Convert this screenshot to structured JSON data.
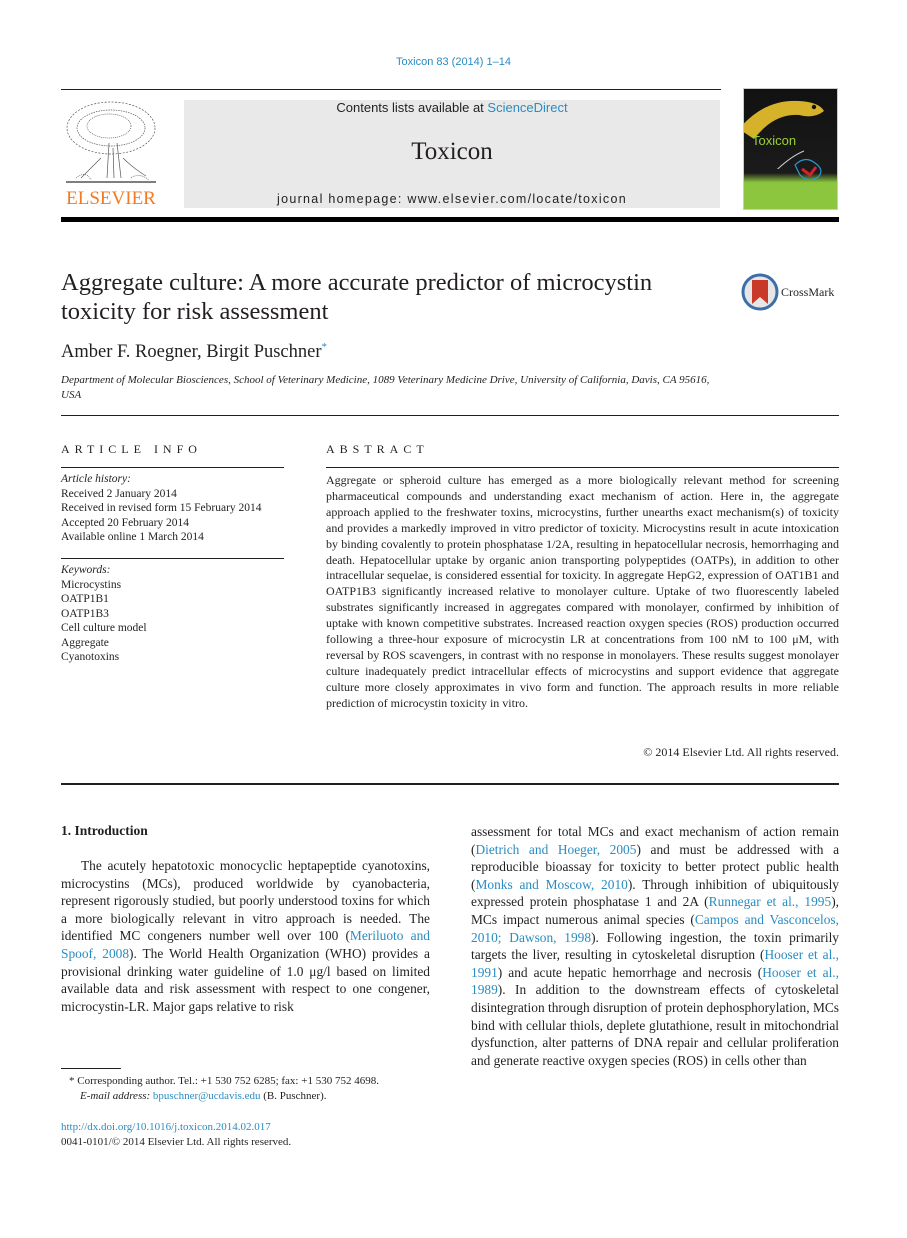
{
  "journal_ref": "Toxicon 83 (2014) 1–14",
  "header": {
    "publisher_logo_label": "ELSEVIER",
    "contents_prefix": "Contents lists available at ",
    "contents_link": "ScienceDirect",
    "journal_name": "Toxicon",
    "homepage": "journal homepage: www.elsevier.com/locate/toxicon",
    "cover_title": "Toxicon"
  },
  "article": {
    "title": "Aggregate culture: A more accurate predictor of microcystin toxicity for risk assessment",
    "crossmark_label": "CrossMark",
    "authors": "Amber F. Roegner, Birgit Puschner",
    "corresponding_mark": "*",
    "affiliation": "Department of Molecular Biosciences, School of Veterinary Medicine, 1089 Veterinary Medicine Drive, University of California, Davis, CA 95616, USA"
  },
  "article_info": {
    "heading": "ARTICLE INFO",
    "history_label": "Article history:",
    "history": [
      "Received 2 January 2014",
      "Received in revised form 15 February 2014",
      "Accepted 20 February 2014",
      "Available online 1 March 2014"
    ],
    "keywords_label": "Keywords:",
    "keywords": [
      "Microcystins",
      "OATP1B1",
      "OATP1B3",
      "Cell culture model",
      "Aggregate",
      "Cyanotoxins"
    ]
  },
  "abstract": {
    "heading": "ABSTRACT",
    "text": "Aggregate or spheroid culture has emerged as a more biologically relevant method for screening pharmaceutical compounds and understanding exact mechanism of action. Here in, the aggregate approach applied to the freshwater toxins, microcystins, further unearths exact mechanism(s) of toxicity and provides a markedly improved in vitro predictor of toxicity. Microcystins result in acute intoxication by binding covalently to protein phos­phatase 1/2A, resulting in hepatocellular necrosis, hemorrhaging and death. Hepatocel­lular uptake by organic anion transporting polypeptides (OATPs), in addition to other intracellular sequelae, is considered essential for toxicity. In aggregate HepG2, expression of OAT1B1 and OATP1B3 significantly increased relative to monolayer culture. Uptake of two fluorescently labeled substrates significantly increased in aggregates compared with monolayer, confirmed by inhibition of uptake with known competitive substrates. Increased reaction oxygen species (ROS) production occurred following a three-hour exposure of microcystin LR at concentrations from 100 nM to 100 μM, with reversal by ROS scavengers, in contrast with no response in monolayers. These results suggest monolayer culture inadequately predict intracellular effects of microcystins and support evidence that aggregate culture more closely approximates in vivo form and function. The approach results in more reliable prediction of microcystin toxicity in vitro.",
    "copyright": "© 2014 Elsevier Ltd. All rights reserved."
  },
  "introduction": {
    "heading": "1.  Introduction",
    "col1": [
      {
        "t": "The acutely hepatotoxic monocyclic heptapeptide cya­notoxins, microcystins (MCs), produced worldwide by cyanobacteria, represent rigorously studied, but poorly understood toxins for which a more biologically relevant in vitro approach is needed. The identified MC congeners number well over 100 ("
      },
      {
        "t": "Meriluoto and Spoof, 2008",
        "link": true
      },
      {
        "t": "). The World Health Organization (WHO) provides a provisional drinking water guideline of 1.0 μg/l based on limited available data and risk assessment with respect to one congener, microcystin-LR. Major gaps relative to risk"
      }
    ],
    "col2": [
      {
        "t": "assessment for total MCs and exact mechanism of action remain ("
      },
      {
        "t": "Dietrich and Hoeger, 2005",
        "link": true
      },
      {
        "t": ") and must be addressed with a reproducible bioassay for toxicity to better protect public health ("
      },
      {
        "t": "Monks and Moscow, 2010",
        "link": true
      },
      {
        "t": "). Through inhibi­tion of ubiquitously expressed protein phosphatase 1 and 2A ("
      },
      {
        "t": "Runnegar et al., 1995",
        "link": true
      },
      {
        "t": "), MCs impact numerous animal species ("
      },
      {
        "t": "Campos and Vasconcelos, 2010; Dawson, 1998",
        "link": true
      },
      {
        "t": "). Following ingestion, the toxin primarily targets the liver, resulting in cytoskeletal disruption ("
      },
      {
        "t": "Hooser et al., 1991",
        "link": true
      },
      {
        "t": ") and acute hepatic hemorrhage and necrosis ("
      },
      {
        "t": "Hooser et al., 1989",
        "link": true
      },
      {
        "t": "). In addition to the downstream effects of cytoskel­etal disintegration through disruption of protein de­phosphorylation, MCs bind with cellular thiols, deplete glutathione, result in mitochondrial dysfunction, alter patterns of DNA repair and cellular proliferation and generate reactive oxygen species (ROS) in cells other than"
      }
    ]
  },
  "footnote": {
    "mark": "*",
    "corresponding": "Corresponding author. Tel.: +1 530 752 6285; fax: +1 530 752 4698.",
    "email_label": "E-mail address:",
    "email": "bpuschner@ucdavis.edu",
    "email_suffix": " (B. Puschner)."
  },
  "doi": {
    "link": "http://dx.doi.org/10.1016/j.toxicon.2014.02.017",
    "issn_line": "0041-0101/© 2014 Elsevier Ltd. All rights reserved."
  },
  "colors": {
    "link": "#2a8cc1",
    "elsevier_orange": "#f47920",
    "header_box": "#e9e9e9"
  }
}
